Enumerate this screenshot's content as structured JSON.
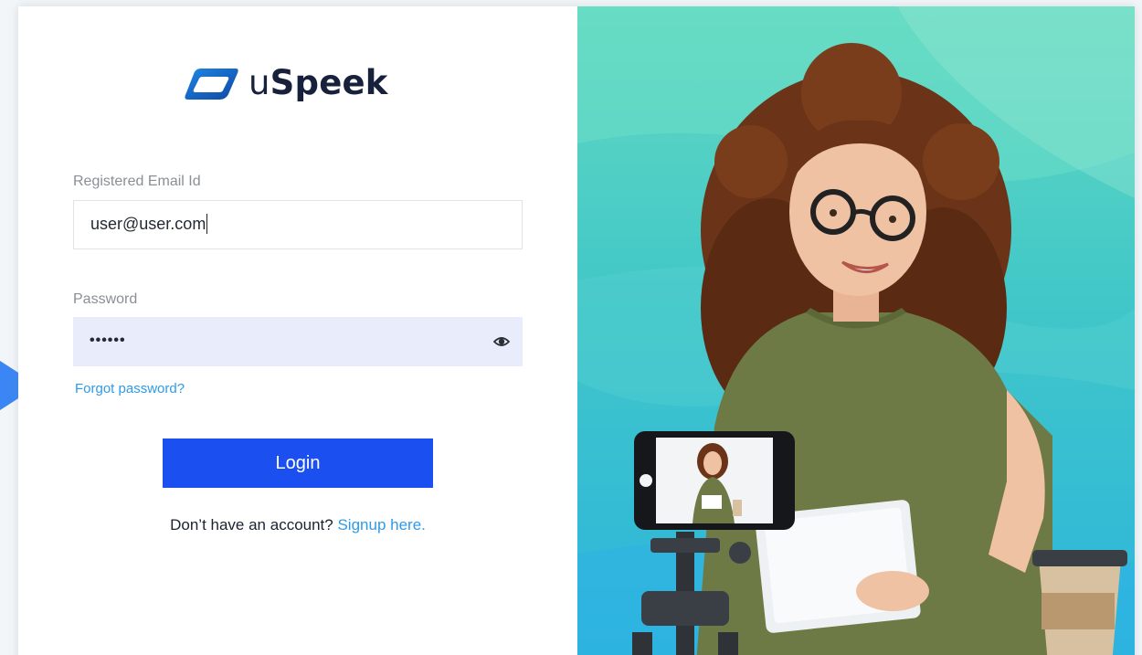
{
  "brand": {
    "name_prefix": "u",
    "name_strong": "Speek",
    "logo_color": "#1a73d9"
  },
  "login_form": {
    "email_label": "Registered Email Id",
    "email_value": "user@user.com",
    "password_label": "Password",
    "password_mask": "••••••",
    "show_password_icon": "eye-icon",
    "forgot_password": "Forgot password?",
    "login_label": "Login",
    "signup_prompt": "Don’t have an account?",
    "signup_link": "Signup here."
  },
  "colors": {
    "primary_button": "#1c4ff0",
    "link": "#2d9be8",
    "hero_gradient_top": "#63d9c1",
    "hero_gradient_bottom": "#2bb4de"
  },
  "hero": {
    "subject": "smiling woman with curly hair, glasses, olive t-shirt holding a tablet, phone on tripod recording her, coffee cup"
  }
}
